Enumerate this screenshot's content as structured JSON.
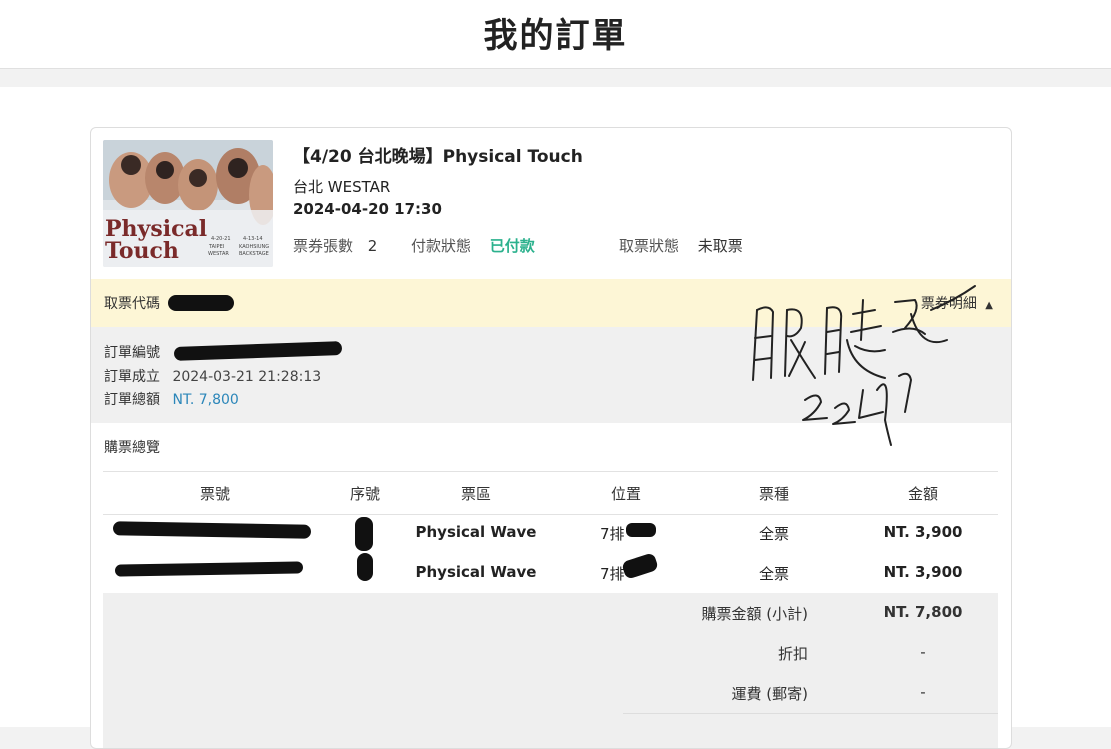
{
  "header": {
    "title": "我的訂單"
  },
  "order": {
    "event_title": "【4/20 台北晚場】Physical Touch",
    "venue": "台北 WESTAR",
    "datetime": "2024-04-20 17:30",
    "ticket_count_label": "票券張數",
    "ticket_count": "2",
    "payment_status_label": "付款狀態",
    "payment_status": "已付款",
    "pickup_status_label": "取票狀態",
    "pickup_status": "未取票",
    "pickup_code_label": "取票代碼",
    "ticket_detail_label": "票券明細",
    "order_no_label": "訂單編號",
    "created_label": "訂單成立",
    "created_value": "2024-03-21 21:28:13",
    "total_label": "訂單總額",
    "total_value": "NT. 7,800"
  },
  "poster": {
    "title_line1": "Physical",
    "title_line2": "Touch",
    "left_caption": "4-20-21",
    "left_city": "TAIPEI",
    "left_venue": "WESTAR",
    "right_caption": "4-13-14",
    "right_city": "KAOHSIUNG",
    "right_venue": "BACKSTAGE"
  },
  "purchase": {
    "section_title": "購票總覽",
    "columns": [
      "票號",
      "序號",
      "票區",
      "位置",
      "票種",
      "金額"
    ],
    "rows": [
      {
        "zone": "Physical Wave",
        "seat": "7排",
        "type": "全票",
        "amount": "NT. 3,900"
      },
      {
        "zone": "Physical Wave",
        "seat": "7排",
        "type": "全票",
        "amount": "NT. 3,900"
      }
    ],
    "subtotal_label": "購票金額 (小計)",
    "subtotal_value": "NT. 7,800",
    "discount_label": "折扣",
    "discount_value": "-",
    "shipping_label": "運費 (郵寄)",
    "shipping_value": "-"
  },
  "colors": {
    "paid_green": "#2bb18d",
    "link_blue": "#2b86b9",
    "pickup_bar": "#fdf6d6"
  }
}
